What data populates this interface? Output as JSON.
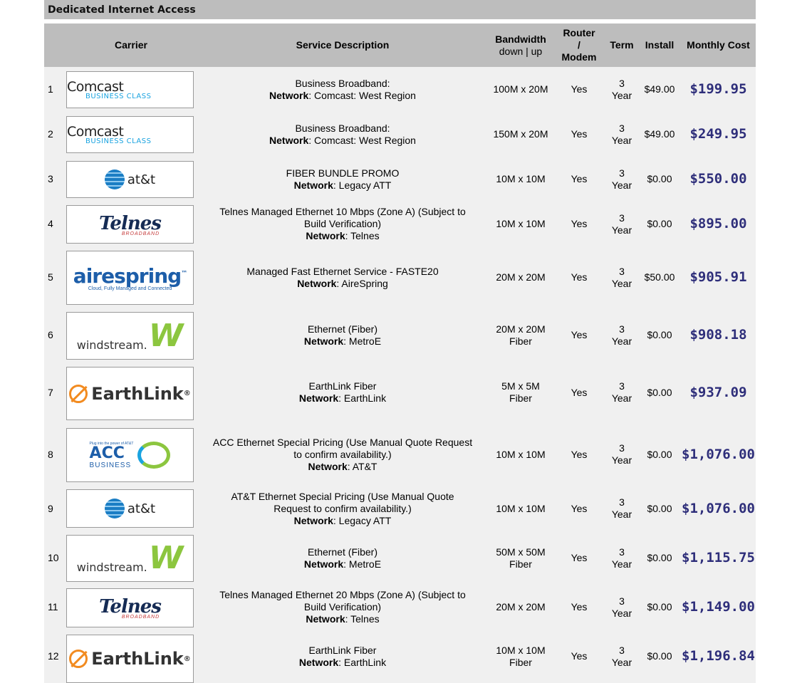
{
  "section": {
    "title": "Dedicated Internet Access"
  },
  "headers": {
    "carrier": "Carrier",
    "description": "Service Description",
    "bandwidth": "Bandwidth",
    "bandwidth_sub": "down | up",
    "router_line1": "Router",
    "router_line2": "/",
    "router_line3": "Modem",
    "term": "Term",
    "install": "Install",
    "monthly": "Monthly Cost"
  },
  "network_label": "Network",
  "rows": [
    {
      "num": "1",
      "logo": "comcast",
      "desc": [
        "Business Broadband:"
      ],
      "network": ": Comcast: West Region",
      "bw": [
        "100M x 20M"
      ],
      "router": "Yes",
      "term": [
        "3",
        "Year"
      ],
      "install": "$49.00",
      "cost": "$199.95"
    },
    {
      "num": "2",
      "logo": "comcast",
      "desc": [
        "Business Broadband:"
      ],
      "network": ": Comcast: West Region",
      "bw": [
        "150M x 20M"
      ],
      "router": "Yes",
      "term": [
        "3",
        "Year"
      ],
      "install": "$49.00",
      "cost": "$249.95"
    },
    {
      "num": "3",
      "logo": "att",
      "desc": [
        "FIBER BUNDLE PROMO"
      ],
      "network": ": Legacy ATT",
      "bw": [
        "10M x 10M"
      ],
      "router": "Yes",
      "term": [
        "3",
        "Year"
      ],
      "install": "$0.00",
      "cost": "$550.00"
    },
    {
      "num": "4",
      "logo": "telnes",
      "desc": [
        "Telnes Managed Ethernet 10 Mbps (Zone A) (Subject to",
        "Build Verification)"
      ],
      "network": ": Telnes",
      "bw": [
        "10M x 10M"
      ],
      "router": "Yes",
      "term": [
        "3",
        "Year"
      ],
      "install": "$0.00",
      "cost": "$895.00"
    },
    {
      "num": "5",
      "logo": "airespring",
      "desc": [
        "Managed Fast Ethernet Service - FASTE20"
      ],
      "network": ": AireSpring",
      "bw": [
        "20M x 20M"
      ],
      "router": "Yes",
      "term": [
        "3",
        "Year"
      ],
      "install": "$50.00",
      "cost": "$905.91"
    },
    {
      "num": "6",
      "logo": "windstream",
      "desc": [
        "Ethernet (Fiber)"
      ],
      "network": ": MetroE",
      "bw": [
        "20M x 20M",
        "Fiber"
      ],
      "router": "Yes",
      "term": [
        "3",
        "Year"
      ],
      "install": "$0.00",
      "cost": "$908.18"
    },
    {
      "num": "7",
      "logo": "earthlink",
      "desc": [
        "EarthLink Fiber"
      ],
      "network": ": EarthLink",
      "bw": [
        "5M x 5M",
        "Fiber"
      ],
      "router": "Yes",
      "term": [
        "3",
        "Year"
      ],
      "install": "$0.00",
      "cost": "$937.09"
    },
    {
      "num": "8",
      "logo": "acc",
      "desc": [
        "ACC Ethernet Special Pricing (Use Manual Quote Request",
        "to confirm availability.)"
      ],
      "network": ": AT&T",
      "bw": [
        "10M x 10M"
      ],
      "router": "Yes",
      "term": [
        "3",
        "Year"
      ],
      "install": "$0.00",
      "cost": "$1,076.00"
    },
    {
      "num": "9",
      "logo": "att",
      "desc": [
        "AT&T Ethernet Special Pricing (Use Manual Quote",
        "Request to confirm availability.)"
      ],
      "network": ": Legacy ATT",
      "bw": [
        "10M x 10M"
      ],
      "router": "Yes",
      "term": [
        "3",
        "Year"
      ],
      "install": "$0.00",
      "cost": "$1,076.00"
    },
    {
      "num": "10",
      "logo": "windstream",
      "desc": [
        "Ethernet (Fiber)"
      ],
      "network": ": MetroE",
      "bw": [
        "50M x 50M",
        "Fiber"
      ],
      "router": "Yes",
      "term": [
        "3",
        "Year"
      ],
      "install": "$0.00",
      "cost": "$1,115.75"
    },
    {
      "num": "11",
      "logo": "telnes",
      "desc": [
        "Telnes Managed Ethernet 20 Mbps (Zone A) (Subject to",
        "Build Verification)"
      ],
      "network": ": Telnes",
      "bw": [
        "20M x 20M"
      ],
      "router": "Yes",
      "term": [
        "3",
        "Year"
      ],
      "install": "$0.00",
      "cost": "$1,149.00"
    },
    {
      "num": "12",
      "logo": "earthlink",
      "desc": [
        "EarthLink Fiber"
      ],
      "network": ": EarthLink",
      "bw": [
        "10M x 10M",
        "Fiber"
      ],
      "router": "Yes",
      "term": [
        "3",
        "Year"
      ],
      "install": "$0.00",
      "cost": "$1,196.84"
    }
  ],
  "logos": {
    "comcast": {
      "name": "Comcast",
      "sub": "BUSINESS CLASS"
    },
    "att": {
      "name": "at&t",
      "icon": "globe-icon"
    },
    "telnes": {
      "name": "Telnes",
      "sub": "BROADBAND"
    },
    "airespring": {
      "name": "airespring",
      "tag": "Cloud, Fully Managed and Connected",
      "tm": "™"
    },
    "windstream": {
      "name": "windstream.",
      "mark": "W"
    },
    "earthlink": {
      "name": "EarthLink",
      "icon": "orbit-icon",
      "reg": "®"
    },
    "acc": {
      "plug": "Plug into the power of AT&T",
      "name": "ACC",
      "sub": "BUSINESS"
    }
  },
  "colors": {
    "header_bg": "#bdbdbd",
    "body_bg": "#f0f0f0",
    "cost": "#2e2e7a"
  }
}
